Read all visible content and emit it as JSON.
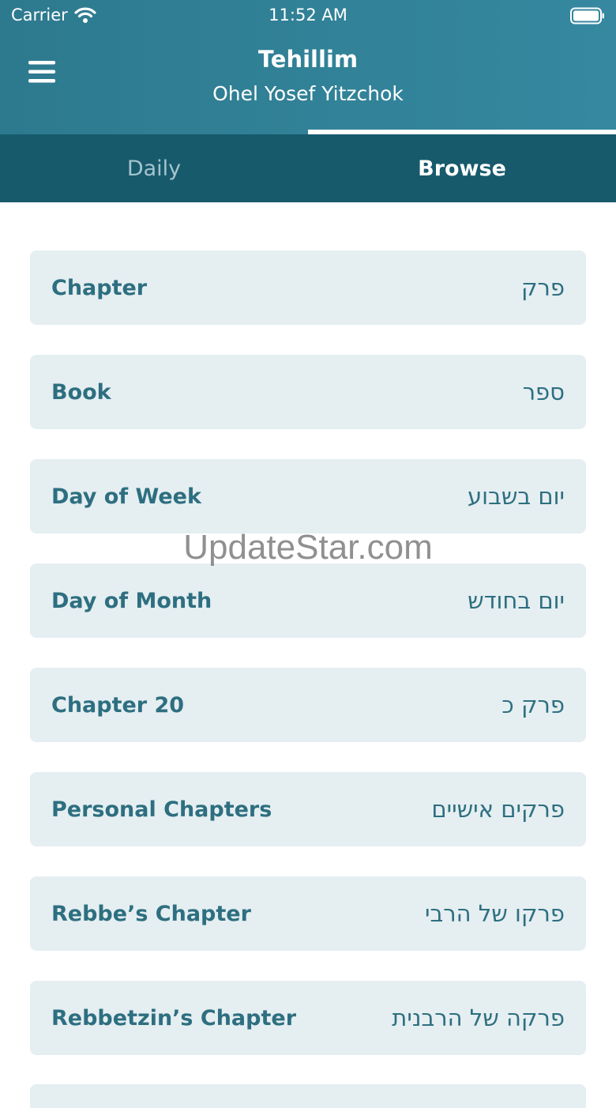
{
  "status_bar": {
    "carrier": "Carrier",
    "time": "11:52 AM"
  },
  "header": {
    "title": "Tehillim",
    "subtitle": "Ohel Yosef Yitzchok"
  },
  "tabs": [
    {
      "label": "Daily",
      "selected": false
    },
    {
      "label": "Browse",
      "selected": true
    }
  ],
  "items": [
    {
      "en": "Chapter",
      "he": "פרק"
    },
    {
      "en": "Book",
      "he": "ספר"
    },
    {
      "en": "Day of Week",
      "he": "יום בשבוע"
    },
    {
      "en": "Day of Month",
      "he": "יום בחודש"
    },
    {
      "en": "Chapter 20",
      "he": "פרק כ"
    },
    {
      "en": "Personal Chapters",
      "he": "פרקים אישיים"
    },
    {
      "en": "Rebbe’s Chapter",
      "he": "פרקו של הרבי"
    },
    {
      "en": "Rebbetzin’s Chapter",
      "he": "פרקה של הרבנית"
    }
  ],
  "watermark": "UpdateStar.com",
  "colors": {
    "header": "#2d7a8e",
    "tab_bar": "#175a6c",
    "item_bg": "#e5eef1",
    "item_text": "#2d6f80"
  },
  "icons": {
    "menu": "hamburger-menu-icon",
    "wifi": "wifi-icon",
    "battery": "battery-icon"
  }
}
